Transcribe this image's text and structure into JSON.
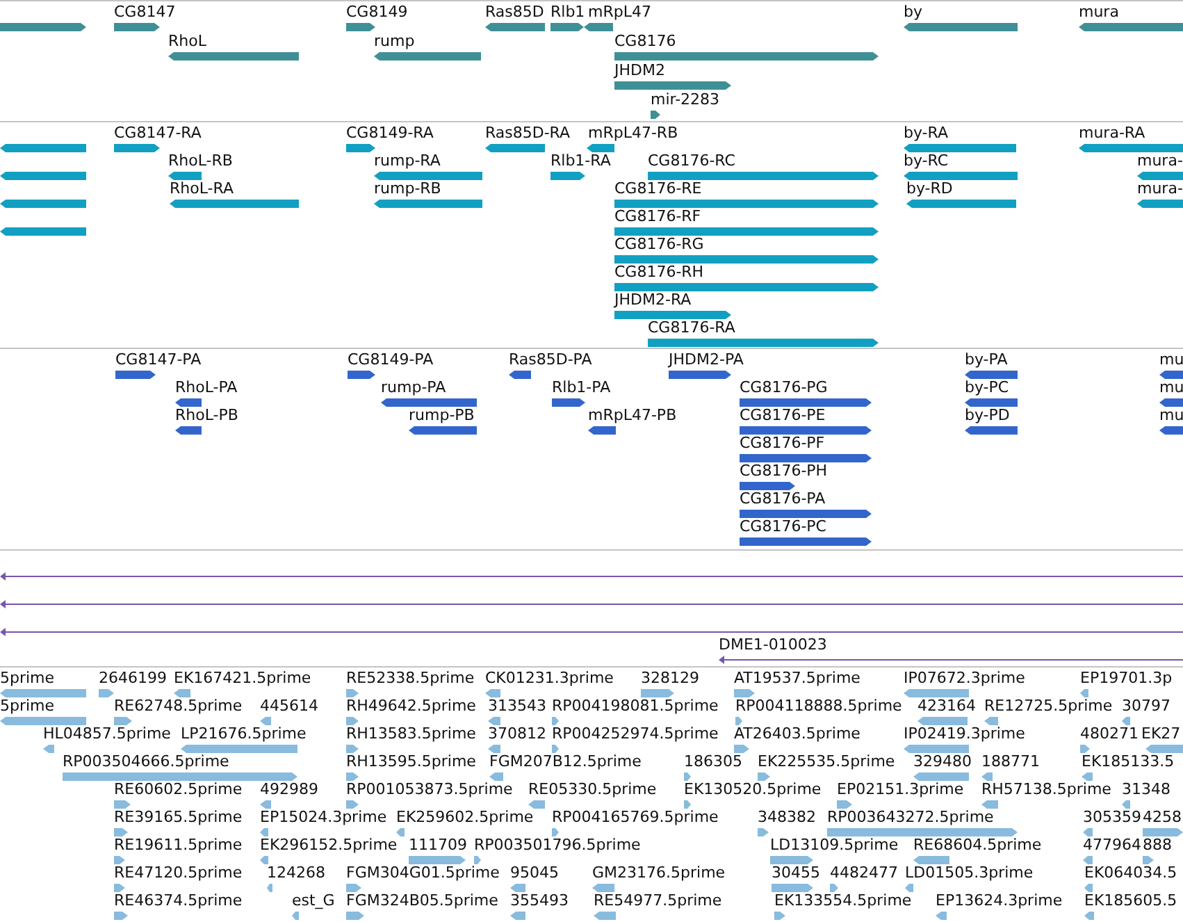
{
  "tracks": [
    {
      "kind": "gene",
      "features": [
        {
          "forward": true
        },
        {
          "label": "CG8147",
          "forward": true
        },
        {
          "label": "CG8149",
          "forward": true
        },
        {
          "label": "Ras85D",
          "forward": false
        },
        {
          "label": "Rlb1",
          "forward": true
        },
        {
          "label": "mRpL47",
          "forward": false
        },
        {
          "label": "by",
          "forward": false
        },
        {
          "label": "mura",
          "forward": false
        },
        {
          "label": "RhoL",
          "forward": false
        },
        {
          "label": "rump",
          "forward": false
        },
        {
          "label": "CG8176",
          "forward": true
        },
        {
          "label": "JHDM2",
          "forward": true
        },
        {
          "label": "mir-2283",
          "forward": true
        }
      ]
    },
    {
      "kind": "transcript",
      "features": [
        {
          "forward": false
        },
        {
          "label": "CG8147-RA",
          "forward": true
        },
        {
          "label": "CG8149-RA",
          "forward": true
        },
        {
          "label": "Ras85D-RA",
          "forward": false
        },
        {
          "label": "mRpL47-RB",
          "forward": false
        },
        {
          "label": "by-RA",
          "forward": false
        },
        {
          "label": "mura-RA",
          "forward": false
        },
        {
          "forward": false
        },
        {
          "label": "RhoL-RB",
          "forward": false
        },
        {
          "label": "rump-RA",
          "forward": false
        },
        {
          "label": "Rlb1-RA",
          "forward": true
        },
        {
          "label": "CG8176-RC",
          "forward": true
        },
        {
          "label": "by-RC",
          "forward": false
        },
        {
          "label": "mura-",
          "forward": false
        },
        {
          "forward": false
        },
        {
          "label": "RhoL-RA",
          "forward": false
        },
        {
          "label": "rump-RB",
          "forward": false
        },
        {
          "label": "CG8176-RE",
          "forward": true
        },
        {
          "label": "by-RD",
          "forward": false
        },
        {
          "label": "mura-",
          "forward": false
        },
        {
          "forward": false
        },
        {
          "label": "CG8176-RF",
          "forward": true
        },
        {
          "label": "CG8176-RG",
          "forward": true
        },
        {
          "label": "CG8176-RH",
          "forward": true
        },
        {
          "label": "JHDM2-RA",
          "forward": true
        },
        {
          "label": "CG8176-RA",
          "forward": true
        }
      ]
    },
    {
      "kind": "protein",
      "features": [
        {
          "label": "CG8147-PA",
          "forward": true
        },
        {
          "label": "CG8149-PA",
          "forward": true
        },
        {
          "label": "Ras85D-PA",
          "forward": false
        },
        {
          "label": "JHDM2-PA",
          "forward": true
        },
        {
          "label": "by-PA",
          "forward": false
        },
        {
          "label": "mu",
          "forward": false
        },
        {
          "label": "RhoL-PA",
          "forward": false
        },
        {
          "label": "rump-PA",
          "forward": false
        },
        {
          "label": "Rlb1-PA",
          "forward": true
        },
        {
          "label": "CG8176-PG",
          "forward": true
        },
        {
          "label": "by-PC",
          "forward": false
        },
        {
          "label": "mu",
          "forward": false
        },
        {
          "label": "RhoL-PB",
          "forward": false
        },
        {
          "label": "rump-PB",
          "forward": false
        },
        {
          "label": "mRpL47-PB",
          "forward": false
        },
        {
          "label": "CG8176-PE",
          "forward": true
        },
        {
          "label": "by-PD",
          "forward": false
        },
        {
          "label": "mu",
          "forward": false
        },
        {
          "label": "CG8176-PF",
          "forward": true
        },
        {
          "label": "CG8176-PH",
          "forward": true
        },
        {
          "label": "CG8176-PA",
          "forward": true
        },
        {
          "label": "CG8176-PC",
          "forward": true
        }
      ]
    },
    {
      "kind": "match",
      "features": [
        {
          "forward": false
        },
        {
          "forward": false
        },
        {
          "forward": false
        },
        {
          "label": "DME1-010023",
          "forward": false
        }
      ]
    },
    {
      "kind": "est",
      "features": [
        {
          "label": "5prime",
          "forward": false
        },
        {
          "label": "2646199",
          "forward": true
        },
        {
          "label": "EK167421.5prime",
          "forward": false
        },
        {
          "label": "RE52338.5prime",
          "forward": true
        },
        {
          "label": "CK01231.3prime",
          "forward": false
        },
        {
          "label": "328129",
          "forward": true
        },
        {
          "label": "AT19537.5prime",
          "forward": true
        },
        {
          "label": "IP07672.3prime",
          "forward": false
        },
        {
          "label": "EP19701.3p",
          "forward": false
        },
        {
          "label": "5prime",
          "forward": false
        },
        {
          "label": "RE62748.5prime",
          "forward": true
        },
        {
          "label": "445614",
          "forward": false
        },
        {
          "label": "RH49642.5prime",
          "forward": true
        },
        {
          "label": "313543",
          "forward": false
        },
        {
          "label": "RP004198081.5prime",
          "forward": true
        },
        {
          "label": "RP004118888.5prime",
          "forward": true
        },
        {
          "label": "423164",
          "forward": false
        },
        {
          "label": "RE12725.5prime",
          "forward": false
        },
        {
          "label": "30797",
          "forward": false
        },
        {
          "label": "HL04857.5prime",
          "forward": false
        },
        {
          "label": "LP21676.5prime",
          "forward": false
        },
        {
          "label": "RH13583.5prime",
          "forward": true
        },
        {
          "label": "370812",
          "forward": false
        },
        {
          "label": "RP004252974.5prime",
          "forward": true
        },
        {
          "label": "AT26403.5prime",
          "forward": true
        },
        {
          "label": "IP02419.3prime",
          "forward": false
        },
        {
          "label": "480271",
          "forward": true
        },
        {
          "label": "EK27",
          "forward": false
        },
        {
          "label": "RP003504666.5prime",
          "forward": true
        },
        {
          "label": "RH13595.5prime",
          "forward": true
        },
        {
          "label": "FGM207B12.5prime",
          "forward": false
        },
        {
          "label": "186305",
          "forward": true
        },
        {
          "label": "EK225535.5prime",
          "forward": true
        },
        {
          "label": "329480",
          "forward": false
        },
        {
          "label": "188771",
          "forward": false
        },
        {
          "label": "EK185133.5",
          "forward": false
        },
        {
          "label": "RE60602.5prime",
          "forward": true
        },
        {
          "label": "492989",
          "forward": false
        },
        {
          "label": "RP001053873.5prime",
          "forward": true
        },
        {
          "label": "RE05330.5prime",
          "forward": false
        },
        {
          "label": "EK130520.5prime",
          "forward": true
        },
        {
          "label": "EP02151.3prime",
          "forward": true
        },
        {
          "label": "RH57138.5prime",
          "forward": false
        },
        {
          "label": "31348",
          "forward": false
        },
        {
          "label": "RE39165.5prime",
          "forward": true
        },
        {
          "label": "EP15024.3prime",
          "forward": false
        },
        {
          "label": "EK259602.5prime",
          "forward": false
        },
        {
          "label": "RP004165769.5prime",
          "forward": true
        },
        {
          "label": "348382",
          "forward": true
        },
        {
          "label": "RP003643272.5prime",
          "forward": true
        },
        {
          "label": "305359",
          "forward": false
        },
        {
          "label": "4258",
          "forward": true
        },
        {
          "label": "RE19611.5prime",
          "forward": true
        },
        {
          "label": "EK296152.5prime",
          "forward": false
        },
        {
          "label": "111709",
          "forward": true
        },
        {
          "label": "RP003501796.5prime",
          "forward": true
        },
        {
          "label": "LD13109.5prime",
          "forward": true
        },
        {
          "label": "RE68604.5prime",
          "forward": false
        },
        {
          "label": "477964",
          "forward": false
        },
        {
          "label": "888",
          "forward": true
        },
        {
          "label": "RE47120.5prime",
          "forward": true
        },
        {
          "label": "124268",
          "forward": false
        },
        {
          "label": "FGM304G01.5prime",
          "forward": true
        },
        {
          "label": "95045",
          "forward": false
        },
        {
          "label": "GM23176.5prime",
          "forward": false
        },
        {
          "label": "30455",
          "forward": true
        },
        {
          "label": "4482477",
          "forward": true
        },
        {
          "label": "LD01505.3prime",
          "forward": false
        },
        {
          "label": "EK064034.5",
          "forward": false
        },
        {
          "label": "RE46374.5prime",
          "forward": true
        },
        {
          "label": "est_G",
          "forward": false
        },
        {
          "label": "FGM324B05.5prime",
          "forward": true
        },
        {
          "label": "355493",
          "forward": false
        },
        {
          "label": "RE54977.5prime",
          "forward": false
        },
        {
          "label": "EK133554.5prime",
          "forward": true
        },
        {
          "label": "EP13624.3prime",
          "forward": false
        },
        {
          "label": "EK185605.5",
          "forward": false
        }
      ]
    }
  ]
}
